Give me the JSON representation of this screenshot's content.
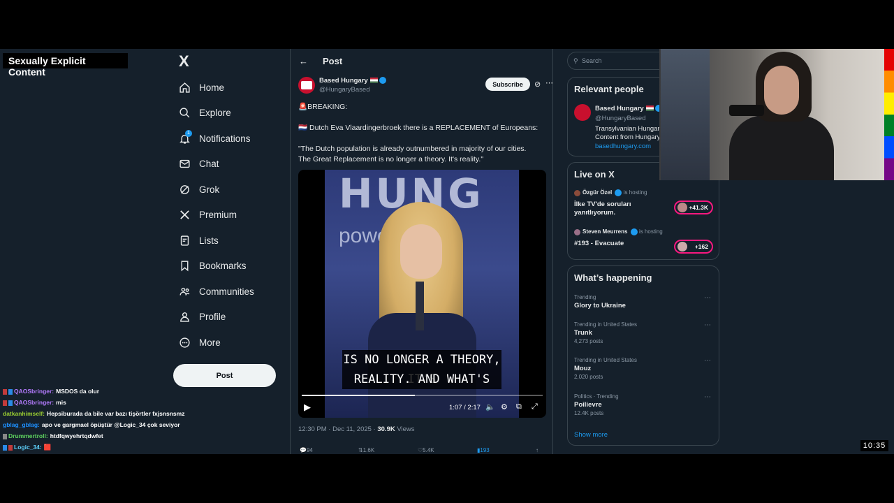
{
  "overlay": {
    "warning_label": "Sexually Explicit Content",
    "clock": "10:35"
  },
  "chat": [
    {
      "user": "QAOSbringer:",
      "user_color": "#b57cff",
      "message": "MSDOS da olur",
      "badge_colors": [
        "#c23b3b",
        "#2b8ae6"
      ]
    },
    {
      "user": "QAOSbringer:",
      "user_color": "#b57cff",
      "message": "mis",
      "badge_colors": [
        "#c23b3b",
        "#2b8ae6"
      ]
    },
    {
      "user": "datkanhimself:",
      "user_color": "#9acd32",
      "message": "Hepsiburada da bile var bazı tişörtler fxjsnsnsmz",
      "badge_colors": []
    },
    {
      "user": "gblag_gblag:",
      "user_color": "#1e90ff",
      "message": "apo ve gargmael öpüştür @Logic_34 çok seviyor",
      "badge_colors": []
    },
    {
      "user": "Drummertroll:",
      "user_color": "#5fd35f",
      "message": "htdfqwyehrtqdwfet",
      "badge_colors": [
        "#888888"
      ]
    },
    {
      "user": "Logic_34:",
      "user_color": "#5fd3ff",
      "message": "🟥",
      "badge_colors": [
        "#2b8ae6",
        "#c23b3b"
      ]
    }
  ],
  "nav": {
    "logo": "X",
    "items": [
      {
        "label": "Home",
        "icon": "home-icon"
      },
      {
        "label": "Explore",
        "icon": "search-icon"
      },
      {
        "label": "Notifications",
        "icon": "bell-icon",
        "badge": "1"
      },
      {
        "label": "Chat",
        "icon": "mail-icon"
      },
      {
        "label": "Grok",
        "icon": "grok-icon"
      },
      {
        "label": "Premium",
        "icon": "x-icon"
      },
      {
        "label": "Lists",
        "icon": "list-icon"
      },
      {
        "label": "Bookmarks",
        "icon": "bookmark-icon"
      },
      {
        "label": "Communities",
        "icon": "communities-icon"
      },
      {
        "label": "Profile",
        "icon": "person-icon"
      },
      {
        "label": "More",
        "icon": "more-circle-icon"
      }
    ],
    "post_button": "Post"
  },
  "post": {
    "header_title": "Post",
    "author_name": "Based Hungary",
    "author_handle": "@HungaryBased",
    "subscribe_label": "Subscribe",
    "text_lines": [
      "🚨BREAKING:",
      "🇳🇱 Dutch Eva Vlaardingerbroek there is a REPLACEMENT of Europeans:",
      "\"The Dutch population is already outnumbered in majority of our cities.",
      "The Great Replacement is no longer a theory. It's reality.\""
    ],
    "video": {
      "bg_text_1": "HUNG",
      "bg_text_2": "power by",
      "subtitle_line_1": "IS NO LONGER A THEORY, IT'S",
      "subtitle_line_2": "REALITY. AND WHAT'S",
      "time": "1:07 / 2:17",
      "progress": 0.47
    },
    "timestamp": "12:30 PM · Dec 11, 2025 · ",
    "views_count": "30.9K",
    "views_label": " Views",
    "engagement": {
      "replies": "94",
      "reposts": "1.6K",
      "likes": "5.4K",
      "bookmarks": "193"
    }
  },
  "sidebar": {
    "search_placeholder": "Search",
    "relevant_title": "Relevant people",
    "relevant_person": {
      "name": "Based Hungary",
      "handle": "@HungaryBased",
      "bio_1": "Transylvanian Hungarian",
      "bio_2": "Content from Hungary",
      "link": "basedhungary.com"
    },
    "live_title": "Live on X",
    "live": [
      {
        "host": "Özgür Özel",
        "hosting": "is hosting",
        "title": "İlke TV'de soruları yanıtlıyorum.",
        "count": "+41.3K"
      },
      {
        "host": "Steven Meurrens",
        "hosting": "is hosting",
        "title": "#193 - Evacuate",
        "count": "+162"
      }
    ],
    "happening_title": "What’s happening",
    "trends": [
      {
        "meta": "Trending",
        "topic": "Glory to Ukraine",
        "count": ""
      },
      {
        "meta": "Trending in United States",
        "topic": "Trunk",
        "count": "4,273 posts"
      },
      {
        "meta": "Trending in United States",
        "topic": "Mouz",
        "count": "2,020 posts"
      },
      {
        "meta": "Politics · Trending",
        "topic": "Poilievre",
        "count": "12.4K posts"
      }
    ],
    "show_more": "Show more"
  },
  "colors": {
    "background": "#15202b",
    "accent": "#1d9bf0",
    "border": "#38444d",
    "live_ring": "#f91880"
  }
}
